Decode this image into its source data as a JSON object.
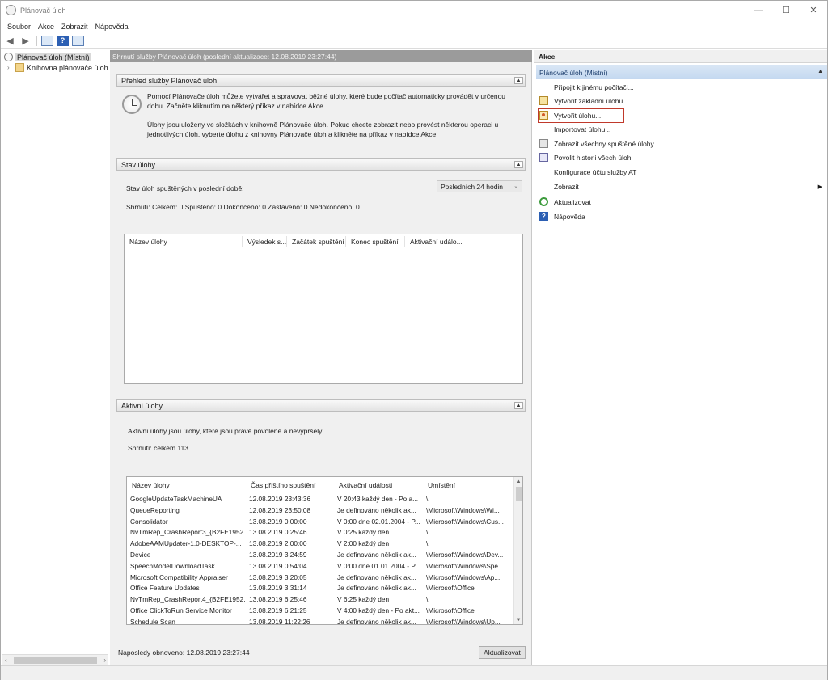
{
  "window": {
    "title": "Plánovač úloh",
    "min": "—",
    "max": "☐",
    "close": "✕"
  },
  "menu": [
    "Soubor",
    "Akce",
    "Zobrazit",
    "Nápověda"
  ],
  "toolbar": {
    "back": "◀",
    "forward": "▶",
    "help": "?"
  },
  "tree": {
    "items": [
      {
        "label": "Plánovač úloh (Místní)"
      },
      {
        "label": "Knihovna plánovače úloh",
        "expander": "›"
      }
    ],
    "scroll_left": "‹",
    "scroll_right": "›"
  },
  "center": {
    "header": "Shrnutí služby Plánovač úloh (poslední aktualizace: 12.08.2019 23:27:44)",
    "overview": {
      "title": "Přehled služby Plánovač úloh",
      "collapse": "▲",
      "p1": "Pomocí Plánovače úloh můžete vytvářet a spravovat běžné úlohy, které bude počítač automaticky provádět v určenou dobu. Začněte kliknutím na některý příkaz v nabídce Akce.",
      "p2": "Úlohy jsou uloženy ve složkách v knihovně Plánovače úloh. Pokud chcete zobrazit nebo provést některou operaci u jednotlivých úloh, vyberte úlohu z knihovny Plánovače úloh a klikněte na příkaz v nabídce Akce."
    },
    "status": {
      "title": "Stav úlohy",
      "collapse": "▲",
      "label": "Stav úloh spuštěných v poslední době:",
      "period": "Posledních 24 hodin",
      "period_arrow": "⌄",
      "summary": "Shrnutí: Celkem: 0 Spuštěno: 0 Dokončeno: 0 Zastaveno: 0 Nedokončeno: 0",
      "columns": [
        "Název úlohy",
        "Výsledek s...",
        "Začátek spuštění",
        "Konec spuštění",
        "Aktivační událo..."
      ]
    },
    "active": {
      "title": "Aktivní úlohy",
      "collapse": "▲",
      "desc": "Aktivní úlohy jsou úlohy, které jsou právě povolené a nevypršely.",
      "summary": "Shrnutí: celkem 113",
      "columns": [
        "Název úlohy",
        "Čas příštího spuštění",
        "Aktivační události",
        "Umístění"
      ],
      "rows": [
        [
          "GoogleUpdateTaskMachineUA",
          "12.08.2019 23:43:36",
          "V 20:43 každý den - Po a...",
          "\\"
        ],
        [
          "QueueReporting",
          "12.08.2019 23:50:08",
          "Je definováno několik ak...",
          "\\Microsoft\\Windows\\Wi..."
        ],
        [
          "Consolidator",
          "13.08.2019 0:00:00",
          "V 0:00 dne 02.01.2004 - P...",
          "\\Microsoft\\Windows\\Cus..."
        ],
        [
          "NvTmRep_CrashReport3_{B2FE1952...",
          "13.08.2019 0:25:46",
          "V 0:25 každý den",
          "\\"
        ],
        [
          "AdobeAAMUpdater-1.0-DESKTOP-...",
          "13.08.2019 2:00:00",
          "V 2:00 každý den",
          "\\"
        ],
        [
          "Device",
          "13.08.2019 3:24:59",
          "Je definováno několik ak...",
          "\\Microsoft\\Windows\\Dev..."
        ],
        [
          "SpeechModelDownloadTask",
          "13.08.2019 0:54:04",
          "V 0:00 dne 01.01.2004 - P...",
          "\\Microsoft\\Windows\\Spe..."
        ],
        [
          "Microsoft Compatibility Appraiser",
          "13.08.2019 3:20:05",
          "Je definováno několik ak...",
          "\\Microsoft\\Windows\\Ap..."
        ],
        [
          "Office Feature Updates",
          "13.08.2019 3:31:14",
          "Je definováno několik ak...",
          "\\Microsoft\\Office"
        ],
        [
          "NvTmRep_CrashReport4_{B2FE1952...",
          "13.08.2019 6:25:46",
          "V 6:25 každý den",
          "\\"
        ],
        [
          "Office ClickToRun Service Monitor",
          "13.08.2019 6:21:25",
          "V 4:00 každý den - Po akt...",
          "\\Microsoft\\Office"
        ],
        [
          "Schedule Scan",
          "13.08.2019 11:22:26",
          "Je definováno několik ak...",
          "\\Microsoft\\Windows\\Up..."
        ]
      ],
      "scroll_up": "▲",
      "scroll_down": "▼"
    },
    "footer": {
      "last_refresh": "Naposledy obnoveno: 12.08.2019 23:27:44",
      "refresh_button": "Aktualizovat"
    }
  },
  "actions": {
    "header": "Akce",
    "group": "Plánovač úloh (Místní)",
    "group_caret": "▲",
    "items": [
      {
        "label": "Připojit k jinému počítači...",
        "icon": "none"
      },
      {
        "label": "Vytvořit základní úlohu...",
        "icon": "basic-task-icon"
      },
      {
        "label": "Vytvořit úlohu...",
        "icon": "create-task-icon"
      },
      {
        "label": "Importovat úlohu...",
        "icon": "none"
      },
      {
        "label": "Zobrazit všechny spuštěné úlohy",
        "icon": "running-tasks-icon"
      },
      {
        "label": "Povolit historii všech úloh",
        "icon": "history-icon"
      },
      {
        "label": "Konfigurace účtu služby AT",
        "icon": "none"
      },
      {
        "label": "Zobrazit",
        "icon": "none",
        "submenu": "▶"
      },
      {
        "label": "Aktualizovat",
        "icon": "refresh-icon"
      },
      {
        "label": "Nápověda",
        "icon": "help-icon",
        "glyph": "?"
      }
    ]
  },
  "colors": {
    "accent": "#c0392b",
    "group_bg": "#c3d8f0",
    "header_bg": "#9b9b9b"
  }
}
